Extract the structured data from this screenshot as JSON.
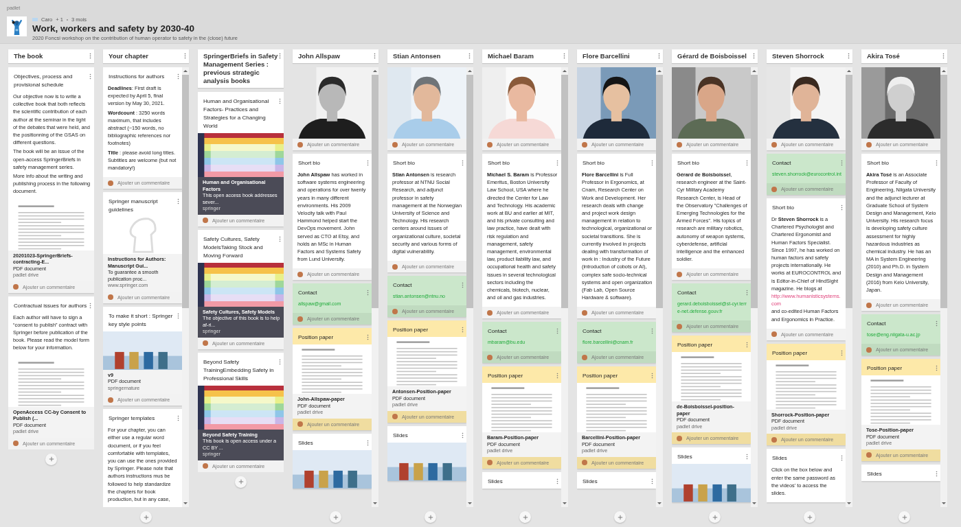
{
  "brand": "padlet",
  "header": {
    "author": "Caro",
    "collaborators": "+ 1",
    "age": "3 mois",
    "title": "Work, workers and safety by 2030-40",
    "description": "2020 Foncsi workshop on the contribution of human operator to safety in the (close) future"
  },
  "columns": [
    {
      "title": "The book",
      "scrollable": false,
      "posts": [
        {
          "color": "#ffffff",
          "title": "Objectives, process and provisional schedule",
          "body": [
            "Our objective now is to write a collective book that both reflects the scientific contribution of each author at the seminar in the light of the debates that were held, and the positionning of the GSAS on different questions.",
            "The book will be an issue of the open-access SpringerBriefs in safety management series.",
            "More info about the writing and publishing process in the following document."
          ],
          "media": {
            "kind": "document"
          },
          "attachment": {
            "kind": "file",
            "name": "20201023-SpringerBriefs-contracting-E...",
            "type": "PDF document",
            "source": "padlet drive"
          },
          "comment": "Ajouter un commentaire"
        },
        {
          "color": "#ffffff",
          "title": "Contractual issues for authors",
          "body": [
            "Each author will have to sign a “consent to publish” contract with Springer before publication of the book. Please read the model form below for your information."
          ],
          "media": {
            "kind": "document"
          },
          "attachment": {
            "kind": "file",
            "name": "OpenAccess CC-by Consent to Publish (...",
            "type": "PDF document",
            "source": "padlet drive"
          },
          "comment": "Ajouter un commentaire"
        }
      ]
    },
    {
      "title": "Your chapter",
      "scrollable": true,
      "posts": [
        {
          "color": "#ffffff",
          "title": "Instructions for authors",
          "body": [
            "**Deadlines**: First draft is expected by April 5, final version by May 30, 2021.",
            "**Wordcount** : 3250 words maximum, that includes abstract (~150 words, no bibliographic references nor footnotes)",
            "**Title** : please avoid long titles. Subtitles are welcome (but not mandatory!)"
          ],
          "comment": "Ajouter un commentaire"
        },
        {
          "color": "#ffffff",
          "title": "Springer manuscript guidelines",
          "media": {
            "kind": "logo"
          },
          "attachment": {
            "kind": "link",
            "name": "Instructions for Authors: Manuscript Gui...",
            "type": "To guarantee a smooth publication proc...",
            "source": "www.springer.com"
          },
          "comment": "Ajouter un commentaire"
        },
        {
          "color": "#ffffff",
          "title": "To make it short : Springer key style points",
          "media": {
            "kind": "slide"
          },
          "attachment": {
            "kind": "file",
            "name": "v9",
            "type": "PDF document",
            "source": "springernature"
          },
          "comment": "Ajouter un commentaire"
        },
        {
          "color": "#ffffff",
          "title": "Springer templates",
          "body": [
            "For your chapter, you can either use a regular word document, or if you feel comfortable with templates, you can use the ones provided by Springer. Please note that authors instructions mus be followed to help standardize the chapters for book production, but in any case,"
          ]
        }
      ]
    },
    {
      "title": "SpringerBriefs in Safety Management Series : previous strategic analysis books",
      "scrollable": false,
      "posts": [
        {
          "color": "#ffffff",
          "title": "Human and Organisational Factors- Practices and Strategies for a Changing World",
          "media": {
            "kind": "book-cover"
          },
          "attachment": {
            "kind": "book",
            "name": "Human and Organisational Factors",
            "type": "This open access book addresses sever...",
            "source": "springer"
          },
          "comment": "Ajouter un commentaire"
        },
        {
          "color": "#ffffff",
          "title": "Safety Cultures, Safety ModelsTaking Stock and Moving Forward",
          "media": {
            "kind": "book-cover"
          },
          "attachment": {
            "kind": "book",
            "name": "Safety Cultures, Safety Models",
            "type": "The objective of this book is to help af-ri...",
            "source": "springer"
          },
          "comment": "Ajouter un commentaire"
        },
        {
          "color": "#ffffff",
          "title": "Beyond Safety TrainingEmbedding Safety in Professional Skills",
          "media": {
            "kind": "book-cover"
          },
          "attachment": {
            "kind": "book",
            "name": "Beyond Safety Training",
            "type": "This book is open access under a CC BY ...",
            "source": "springer"
          },
          "comment": "Ajouter un commentaire"
        }
      ]
    },
    {
      "title": "John Allspaw",
      "scrollable": true,
      "posts": [
        {
          "color": "#ffffff",
          "comment": "Ajouter un commentaire"
        },
        {
          "color": "#ffffff",
          "title": "Short bio",
          "body": [
            "**John Allspaw** has worked in software systems engineering and operations for over twenty years in many different environments. His 2009 Velocity talk with Paul Hammond helped start the DevOps movement. John served as CTO at Etsy, and holds an MSc in Human Factors and Systems Safety from Lund University."
          ],
          "comment": "Ajouter un commentaire"
        },
        {
          "color": "#cbe7cb",
          "title": "Contact",
          "link": "allspaw@gmail.com",
          "comment": "Ajouter un commentaire"
        },
        {
          "color": "#fde9a9",
          "title": "Position paper",
          "media": {
            "kind": "document"
          },
          "attachment": {
            "kind": "file",
            "name": "John-Allspaw-paper",
            "type": "PDF document",
            "source": "padlet drive"
          },
          "comment": "Ajouter un commentaire"
        },
        {
          "color": "#ffffff",
          "title": "Slides",
          "media": {
            "kind": "slide"
          }
        }
      ]
    },
    {
      "title": "Stian Antonsen",
      "scrollable": true,
      "posts": [
        {
          "color": "#ffffff",
          "comment": "Ajouter un commentaire"
        },
        {
          "color": "#ffffff",
          "title": "Short bio",
          "body": [
            "**Stian Antonsen** is research professor at NTNU Social Research, and adjunct professor in safety management at the Norwegian University of Science and Technology. His research centers around issues of organizational culture, societal security and various forms of digital vulnerability."
          ],
          "comment": "Ajouter un commentaire"
        },
        {
          "color": "#cbe7cb",
          "title": "Contact",
          "link": "stian.antonsen@ntnu.no",
          "comment": "Ajouter un commentaire"
        },
        {
          "color": "#fde9a9",
          "title": "Position paper",
          "media": {
            "kind": "document"
          },
          "attachment": {
            "kind": "file",
            "name": "Antonsen-Position-paper",
            "type": "PDF document",
            "source": "padlet drive"
          },
          "comment": "Ajouter un commentaire"
        },
        {
          "color": "#ffffff",
          "title": "Slides",
          "media": {
            "kind": "slide"
          }
        }
      ]
    },
    {
      "title": "Michael Baram",
      "scrollable": true,
      "posts": [
        {
          "color": "#ffffff",
          "comment": "Ajouter un commentaire"
        },
        {
          "color": "#ffffff",
          "title": "Short bio",
          "body": [
            "**Michael S. Baram** is Professor Emeritus, Boston University Law School, USA where he directed the Center for Law and Technology. His academic work at BU and earlier at MIT, and his private consulting and law practice, have dealt with risk regulation and management, safety management, environmental law, product liability law, and occupational health and safety issues in several technological sectors including the chemicals, biotech, nuclear, and oil and gas industries."
          ],
          "comment": "Ajouter un commentaire"
        },
        {
          "color": "#cbe7cb",
          "title": "Contact",
          "link": "mbaram@bu.edu",
          "comment": "Ajouter un commentaire"
        },
        {
          "color": "#fde9a9",
          "title": "Position paper",
          "media": {
            "kind": "document"
          },
          "attachment": {
            "kind": "file",
            "name": "Baram-Position-paper",
            "type": "PDF document",
            "source": "padlet drive"
          },
          "comment": "Ajouter un commentaire"
        },
        {
          "color": "#ffffff",
          "title": "Slides"
        }
      ]
    },
    {
      "title": "Flore Barcellini",
      "scrollable": true,
      "posts": [
        {
          "color": "#ffffff",
          "comment": "Ajouter un commentaire"
        },
        {
          "color": "#ffffff",
          "title": "Short bio",
          "body": [
            "**Flore Barcellini** is Full Professor in Ergonomics, at Cnam, Research Center on Work and Development. Her research deals with change and project work design management in relation to technological, organizational or societal transitions. She is currently involved in  projects dealing with transformation of work in : Industry of the Future (introduction of cobots or AI), complex safe socio-technical systems and open organization (Fab Lab, Open Source Hardware & software)."
          ],
          "comment": "Ajouter un commentaire"
        },
        {
          "color": "#cbe7cb",
          "title": "Contact",
          "link": "flore.barcellini@cnam.fr",
          "comment": "Ajouter un commentaire"
        },
        {
          "color": "#fde9a9",
          "title": "Position paper",
          "media": {
            "kind": "document"
          },
          "attachment": {
            "kind": "file",
            "name": "Barcellini-Position-paper",
            "type": "PDF document",
            "source": "padlet drive"
          },
          "comment": "Ajouter un commentaire"
        },
        {
          "color": "#ffffff",
          "title": "Slides"
        }
      ]
    },
    {
      "title": "Gérard de Boisboissel",
      "scrollable": true,
      "posts": [
        {
          "color": "#ffffff",
          "comment": "Ajouter un commentaire"
        },
        {
          "color": "#ffffff",
          "title": "Short bio",
          "body": [
            "**Gérard de Boisboissel**, research engineer at the Saint-Cyr Military Academy Research Center, is Head of the Observatory \"Challenges of Emerging Technologies for the Armed Forces\". His topics of research are military robotics, autonomy of weapon systems, cyberdefense, artificial intelligence and the enhanced soldier."
          ],
          "comment": "Ajouter un commentaire"
        },
        {
          "color": "#cbe7cb",
          "title": "Contact",
          "link": "gerard.deboisboissel@st-cyr.terre-net.defense.gouv.fr",
          "comment": "Ajouter un commentaire"
        },
        {
          "color": "#fde9a9",
          "title": "Position paper",
          "media": {
            "kind": "document"
          },
          "attachment": {
            "kind": "file",
            "name": "de-Boisboissel-position-paper",
            "type": "PDF document",
            "source": "padlet drive"
          },
          "comment": "Ajouter un commentaire"
        },
        {
          "color": "#ffffff",
          "title": "Slides",
          "media": {
            "kind": "slide"
          }
        }
      ]
    },
    {
      "title": "Steven Shorrock",
      "scrollable": true,
      "posts": [
        {
          "color": "#ffffff",
          "comment": "Ajouter un commentaire"
        },
        {
          "color": "#cbe7cb",
          "title": "Contact",
          "link": "steven.shorrock@eurocontrol.int",
          "comment": "Ajouter un commentaire"
        },
        {
          "color": "#ffffff",
          "title": "Short bio",
          "body": [
            {
              "text": "Dr **Steven Shorrock** is a Chartered Psychologist and Chartered Ergonomist and Human Factors Specialist. Since 1997, he has worked on human factors and safety projects internationally. He works at EUROCONTROL and is Editor-in-Chief of HindSight magazine. He blogs at",
              "link": "http://www.humanisticsystems.com",
              "after": "and co-edited Human Factors and Ergonomics in Practice."
            }
          ],
          "comment": "Ajouter un commentaire"
        },
        {
          "color": "#fde9a9",
          "title": "Position paper",
          "media": {
            "kind": "document"
          },
          "attachment": {
            "kind": "file",
            "name": "Shorrock-Position-paper",
            "type": "PDF document",
            "source": "padlet drive"
          },
          "comment": "Ajouter un commentaire"
        },
        {
          "color": "#ffffff",
          "title": "Slides",
          "body": [
            "Click on the box below and enter the same password  as the videos' to access the slides."
          ]
        }
      ]
    },
    {
      "title": "Akira Tosé",
      "scrollable": true,
      "posts": [
        {
          "color": "#ffffff",
          "comment": "Ajouter un commentaire"
        },
        {
          "color": "#ffffff",
          "title": "Short bio",
          "body": [
            "**Akira Tosé** is an Associate Professor of Faculty of Engineering, Niigata University and the adjunct lecturer at Graduate School of System Design and Management, Keio University. His research focus is developing safety culture assessment for highly hazardous industries as chemical industry. He has an MA in System Engineering (2010) and Ph.D. in System Design and Management (2016) from Keio University, Japan."
          ],
          "comment": "Ajouter un commentaire"
        },
        {
          "color": "#cbe7cb",
          "title": "Contact",
          "link": "tose@eng.niigata-u.ac.jp",
          "comment": "Ajouter un commentaire"
        },
        {
          "color": "#fde9a9",
          "title": "Position paper",
          "media": {
            "kind": "document"
          },
          "attachment": {
            "kind": "file",
            "name": "Tose-Position-paper",
            "type": "PDF document",
            "source": "padlet drive"
          },
          "comment": "Ajouter un commentaire"
        },
        {
          "color": "#ffffff",
          "title": "Slides"
        }
      ]
    }
  ]
}
